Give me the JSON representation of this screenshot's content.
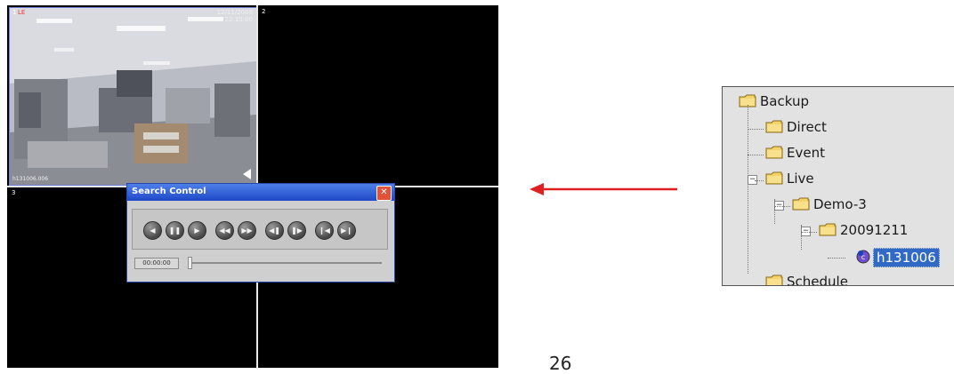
{
  "viewer": {
    "cell1": {
      "number": "1",
      "marker": "LE",
      "date": "12/11/2009",
      "time": "22:10:00",
      "camera": "h131006.006"
    },
    "cell2": {
      "number": "2"
    },
    "cell3": {
      "number": "3"
    }
  },
  "search_control": {
    "title": "Search Control",
    "close_glyph": "✕",
    "buttons": [
      {
        "name": "rewind-start",
        "glyph": "◀"
      },
      {
        "name": "pause",
        "glyph": "❚❚"
      },
      {
        "name": "play",
        "glyph": "▶"
      },
      {
        "name": "fast-rewind",
        "glyph": "◀◀"
      },
      {
        "name": "fast-forward",
        "glyph": "▶▶"
      },
      {
        "name": "step-back",
        "glyph": "◀❚"
      },
      {
        "name": "step-forward",
        "glyph": "❚▶"
      },
      {
        "name": "skip-start",
        "glyph": "❙◀"
      },
      {
        "name": "skip-end",
        "glyph": "▶❙"
      }
    ],
    "time": "00:00:00",
    "seek_position": 0
  },
  "tree": {
    "items": [
      {
        "label": "Backup",
        "level": 0,
        "expander": ""
      },
      {
        "label": "Direct",
        "level": 1,
        "expander": ""
      },
      {
        "label": "Event",
        "level": 1,
        "expander": ""
      },
      {
        "label": "Live",
        "level": 1,
        "expander": "−"
      },
      {
        "label": "Demo-3",
        "level": 2,
        "expander": "−"
      },
      {
        "label": "20091211",
        "level": 3,
        "expander": "−"
      },
      {
        "label": "h131006",
        "level": 4,
        "expander": "",
        "selected": true
      },
      {
        "label": "Schedule",
        "level": 1,
        "expander": ""
      }
    ]
  },
  "page_number": "26",
  "colors": {
    "accent": "#316ac5",
    "arrow": "#e02020",
    "titlebar": "#2b5ce0"
  }
}
